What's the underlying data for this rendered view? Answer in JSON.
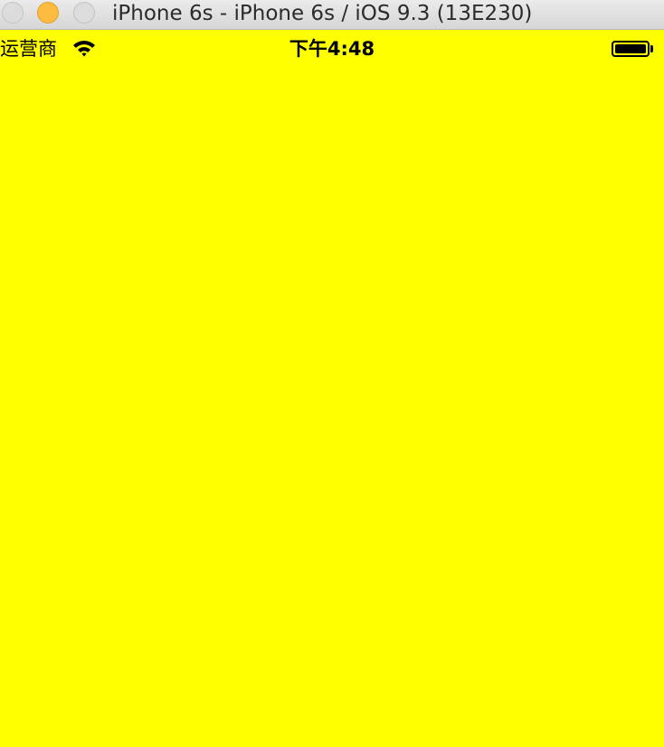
{
  "window": {
    "title": "iPhone 6s - iPhone 6s / iOS 9.3 (13E230)"
  },
  "status_bar": {
    "carrier": "运营商",
    "time": "下午4:48",
    "wifi_icon": "wifi-icon",
    "battery_icon": "battery-full-icon",
    "battery_level": 1.0
  },
  "screen": {
    "background_color": "#ffff00"
  },
  "colors": {
    "minimize_button": "#fdbc40",
    "inactive_button": "#dcdcdc"
  }
}
